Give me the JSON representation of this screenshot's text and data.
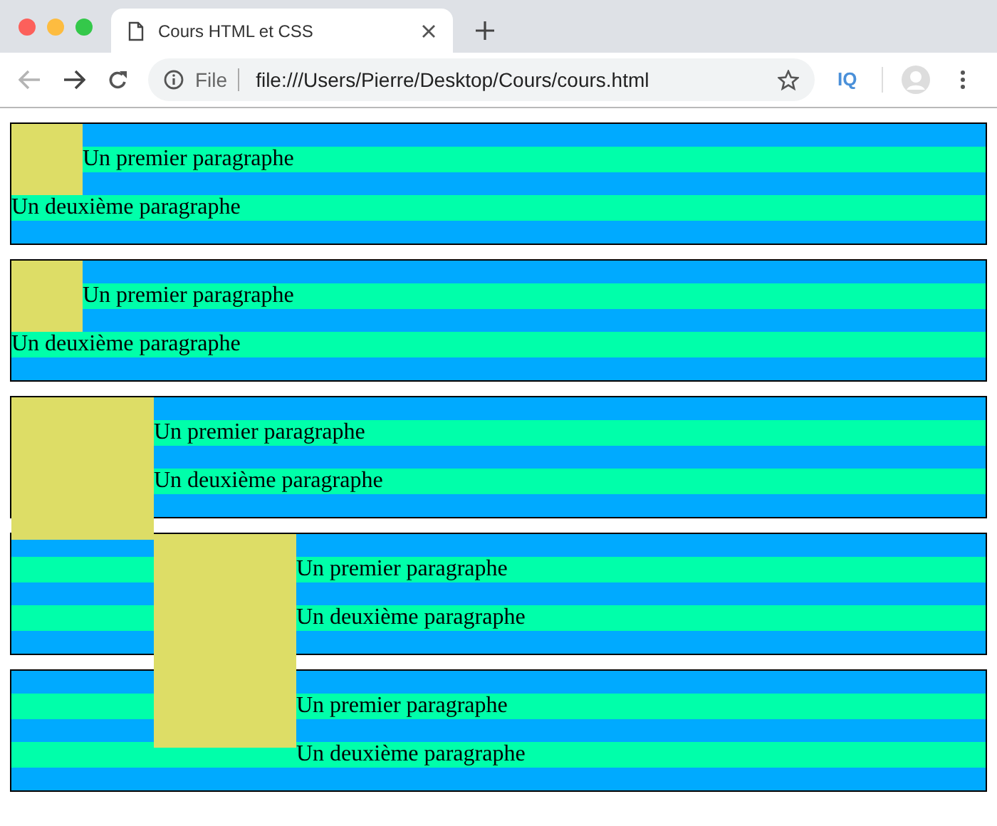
{
  "tab": {
    "title": "Cours HTML et CSS",
    "selected": true
  },
  "address_bar": {
    "security_label": "File",
    "url": "file:///Users/Pierre/Desktop/Cours/cours.html"
  },
  "extension": {
    "label": "IQ"
  },
  "boxes": [
    {
      "kind": "small",
      "paragraphs": [
        "Un premier paragraphe",
        "Un deuxième paragraphe"
      ]
    },
    {
      "kind": "small",
      "paragraphs": [
        "Un premier paragraphe",
        "Un deuxième paragraphe"
      ]
    },
    {
      "kind": "square",
      "paragraphs": [
        "Un premier paragraphe",
        "Un deuxième paragraphe"
      ]
    },
    {
      "kind": "tall",
      "paragraphs": [
        "Un premier paragraphe",
        "Un deuxième paragraphe"
      ]
    },
    {
      "kind": "plain",
      "paragraphs": [
        "Un premier paragraphe",
        "Un deuxième paragraphe"
      ]
    }
  ]
}
